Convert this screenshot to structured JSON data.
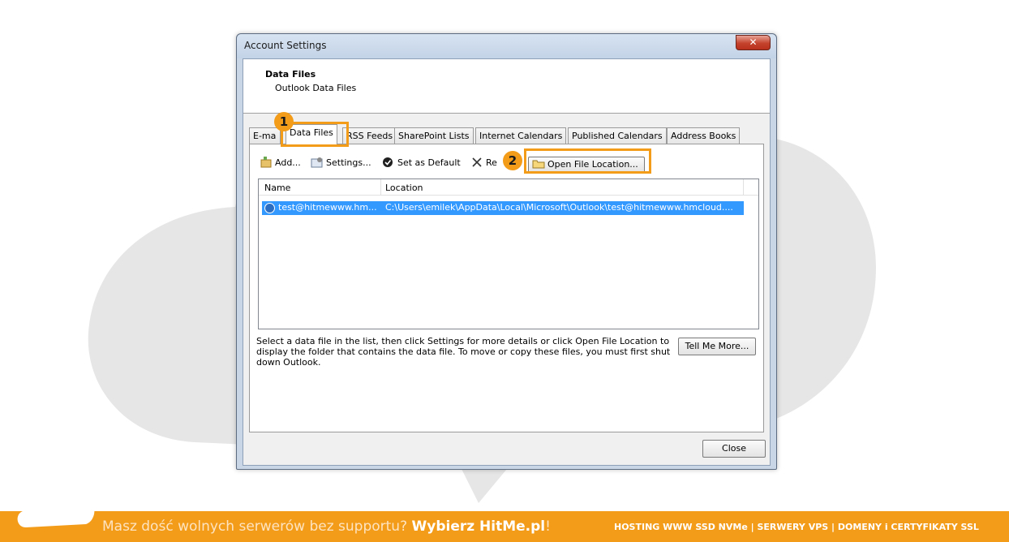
{
  "colors": {
    "accent": "#f39c1a",
    "selection": "#3399ff"
  },
  "dialog": {
    "title": "Account Settings",
    "close_icon": "close-x-icon",
    "header_title": "Data Files",
    "header_subtitle": "Outlook Data Files",
    "tabs": [
      {
        "label": "E-mail",
        "visible": "E-ma"
      },
      {
        "label": "Data Files"
      },
      {
        "label": "RSS Feeds"
      },
      {
        "label": "SharePoint Lists"
      },
      {
        "label": "Internet Calendars"
      },
      {
        "label": "Published Calendars"
      },
      {
        "label": "Address Books"
      }
    ],
    "toolbar": {
      "add": "Add...",
      "settings": "Settings...",
      "set_default": "Set as Default",
      "remove": "Re",
      "open_location": "Open File Location..."
    },
    "list": {
      "columns": [
        "Name",
        "Location"
      ],
      "rows": [
        {
          "name": "test@hitmewww.hm...",
          "location": "C:\\Users\\emilek\\AppData\\Local\\Microsoft\\Outlook\\test@hitmewww.hmcloud...."
        }
      ]
    },
    "info_text": "Select a data file in the list, then click Settings for more details or click Open File Location to display the folder that contains the data file. To move or copy these files, you must first shut down Outlook.",
    "tell_me_more": "Tell Me More...",
    "close": "Close"
  },
  "markers": [
    "1",
    "2"
  ],
  "banner": {
    "text_light": "Masz dość wolnych serwerów bez supportu? ",
    "text_bold": "Wybierz HitMe.pl",
    "text_end": "!",
    "right": "HOSTING WWW SSD NVMe | SERWERY VPS | DOMENY i CERTYFIKATY SSL"
  }
}
